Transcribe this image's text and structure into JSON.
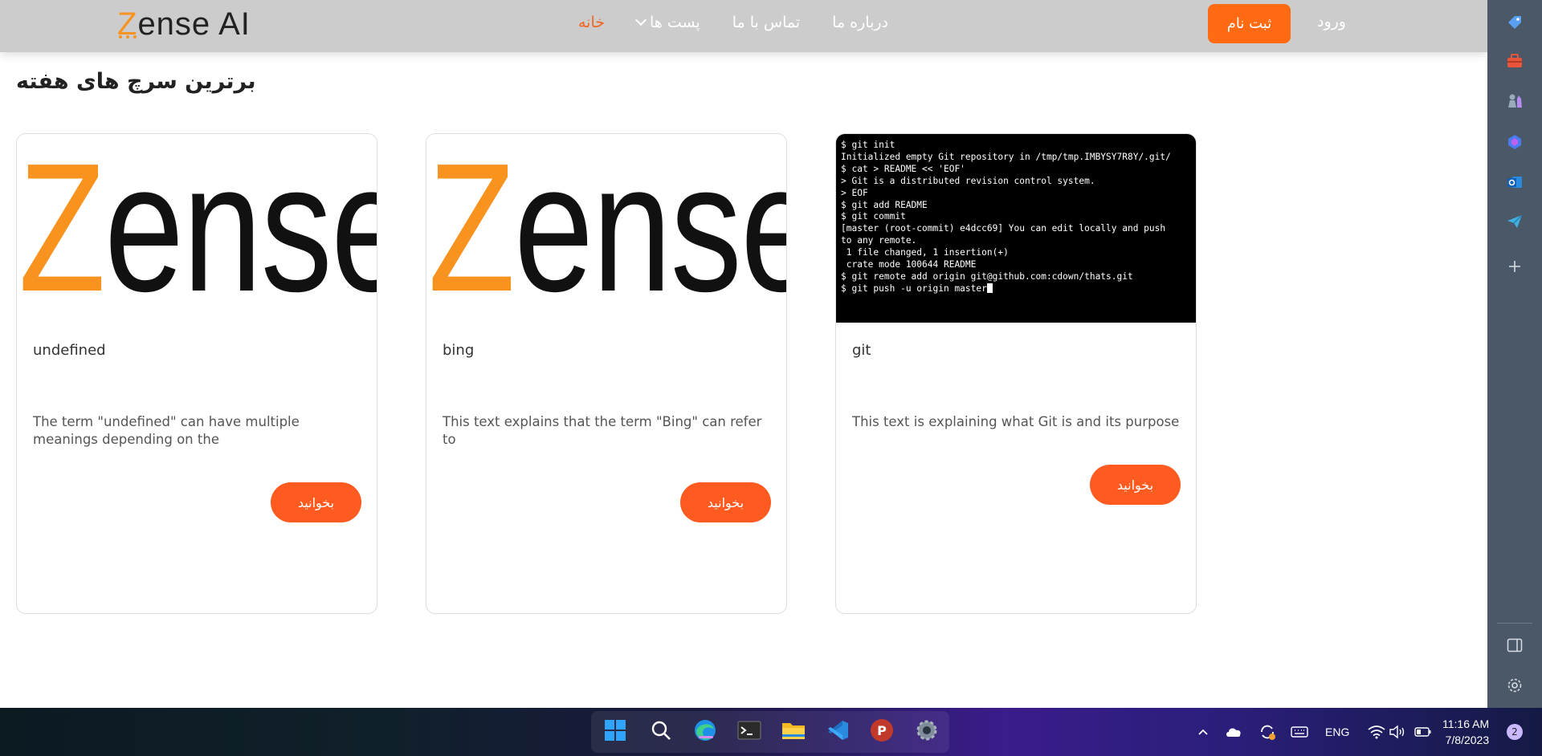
{
  "navbar": {
    "logo_z": "Z",
    "logo_rest": "ense AI",
    "links": [
      {
        "label": "خانه",
        "active": true
      },
      {
        "label": "پست ها",
        "dropdown": true
      },
      {
        "label": "تماس با ما"
      },
      {
        "label": "درباره ما"
      }
    ],
    "register_label": "ثبت نام",
    "login_label": "ورود"
  },
  "section_title": "برترین سرچ های هفته",
  "cards": [
    {
      "image_type": "logo",
      "image_text_z": "Z",
      "image_text_rest": "ense AI",
      "title": "undefined",
      "description": "The term \"undefined\" can have multiple meanings depending on the",
      "button_label": "بخوانید"
    },
    {
      "image_type": "logo",
      "image_text_z": "Z",
      "image_text_rest": "ense AI",
      "title": "bing",
      "description": "This text explains that the term \"Bing\" can refer to",
      "button_label": "بخوانید"
    },
    {
      "image_type": "terminal",
      "terminal_lines": [
        "$ git init",
        "Initialized empty Git repository in /tmp/tmp.IMBYSY7R8Y/.git/",
        "$ cat > README << 'EOF'",
        "> Git is a distributed revision control system.",
        "> EOF",
        "$ git add README",
        "$ git commit",
        "[master (root-commit) e4dcc69] You can edit locally and push",
        "to any remote.",
        " 1 file changed, 1 insertion(+)",
        " crate mode 100644 README",
        "$ git remote add origin git@github.com:cdown/thats.git",
        "$ git push -u origin master"
      ],
      "title": "git",
      "description": "This text is explaining what Git is and its purpose",
      "button_label": "بخوانید"
    }
  ],
  "sidebar": {
    "icons": [
      "tag-icon",
      "toolbox-icon",
      "chess-icon",
      "copilot-icon",
      "outlook-icon",
      "send-icon",
      "add-icon",
      "split-view-icon",
      "settings-icon"
    ]
  },
  "taskbar": {
    "apps": [
      "windows-start-icon",
      "search-icon",
      "edge-icon",
      "terminal-icon",
      "file-explorer-icon",
      "vscode-icon",
      "psiphon-icon",
      "settings-icon"
    ],
    "language": "ENG",
    "time": "11:16 AM",
    "date": "7/8/2023",
    "notification_count": "2"
  },
  "colors": {
    "accent": "#ff6a13",
    "navbar": "#cccccc",
    "sidebar": "#4a5868"
  }
}
